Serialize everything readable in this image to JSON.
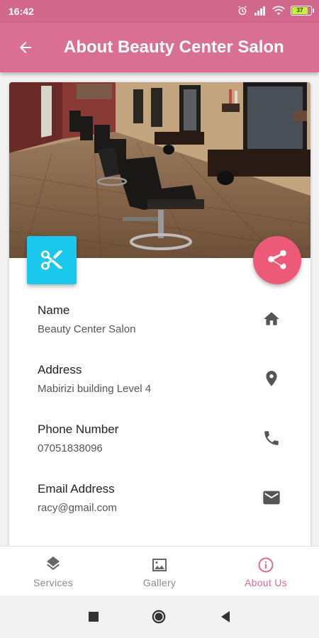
{
  "status_bar": {
    "time": "16:42",
    "battery": "37"
  },
  "app_bar": {
    "title": "About Beauty Center Salon"
  },
  "info": [
    {
      "label": "Name",
      "value": "Beauty Center Salon",
      "icon": "home-icon"
    },
    {
      "label": "Address",
      "value": "Mabirizi building Level 4",
      "icon": "location-pin-icon"
    },
    {
      "label": "Phone Number",
      "value": "07051838096",
      "icon": "phone-icon"
    },
    {
      "label": "Email Address",
      "value": "racy@gmail.com",
      "icon": "mail-icon"
    }
  ],
  "bottom_nav": {
    "items": [
      {
        "label": "Services",
        "icon": "layers-icon"
      },
      {
        "label": "Gallery",
        "icon": "image-icon"
      },
      {
        "label": "About Us",
        "icon": "info-icon",
        "active": true
      }
    ]
  },
  "colors": {
    "app_bar": "#d96f92",
    "status_bar": "#d2688c",
    "accent_cyan": "#19c8ec",
    "share_fab": "#ec5a78",
    "active_nav": "#e0698f"
  }
}
